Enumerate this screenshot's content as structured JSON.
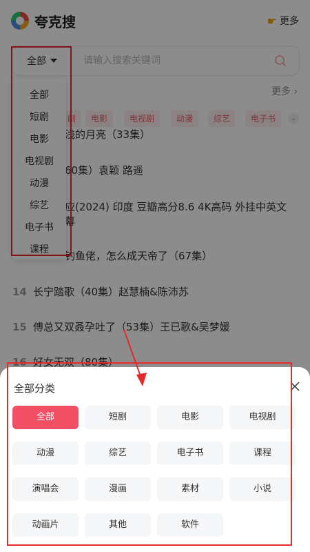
{
  "header": {
    "title": "夸克搜",
    "more_label": "更多"
  },
  "search": {
    "category_selected": "全部",
    "placeholder": "请输入搜索关键词"
  },
  "dropdown": {
    "items": [
      "全部",
      "短剧",
      "电影",
      "电视剧",
      "动漫",
      "综艺",
      "电子书",
      "课程"
    ]
  },
  "background": {
    "more_label": "更多 ›",
    "tags": [
      "剧",
      "电影",
      "电视剧",
      "动漫",
      "综艺",
      "电子书"
    ],
    "list": [
      {
        "num": "",
        "text": "浅的月亮（33集）"
      },
      {
        "num": "",
        "text": "60集）袁颖 路遥"
      },
      {
        "num": "",
        "text": "应(2024) 印度 豆瓣高分8.6 4K高码 外挂中英文"
      },
      {
        "num": "",
        "text": "幕"
      },
      {
        "num": "",
        "text": "钓鱼佬，怎么成天帝了（67集）"
      },
      {
        "num": "14",
        "text": "长宁踏歌（40集）赵慧楠&陈沛苏"
      },
      {
        "num": "15",
        "text": "傅总又双叒孕吐了（53集）王已歌&吴梦媛"
      },
      {
        "num": "16",
        "text": "好女无双（80集）"
      }
    ]
  },
  "sheet": {
    "title": "全部分类",
    "categories": [
      "全部",
      "短剧",
      "电影",
      "电视剧",
      "动漫",
      "综艺",
      "电子书",
      "课程",
      "演唱会",
      "漫画",
      "素材",
      "小说",
      "动画片",
      "其他",
      "软件"
    ],
    "active_index": 0
  },
  "colors": {
    "accent": "#f24e64",
    "annotation_red": "#e8292b",
    "tag_bg": "#fdeeee",
    "tag_text": "#e8626a"
  }
}
